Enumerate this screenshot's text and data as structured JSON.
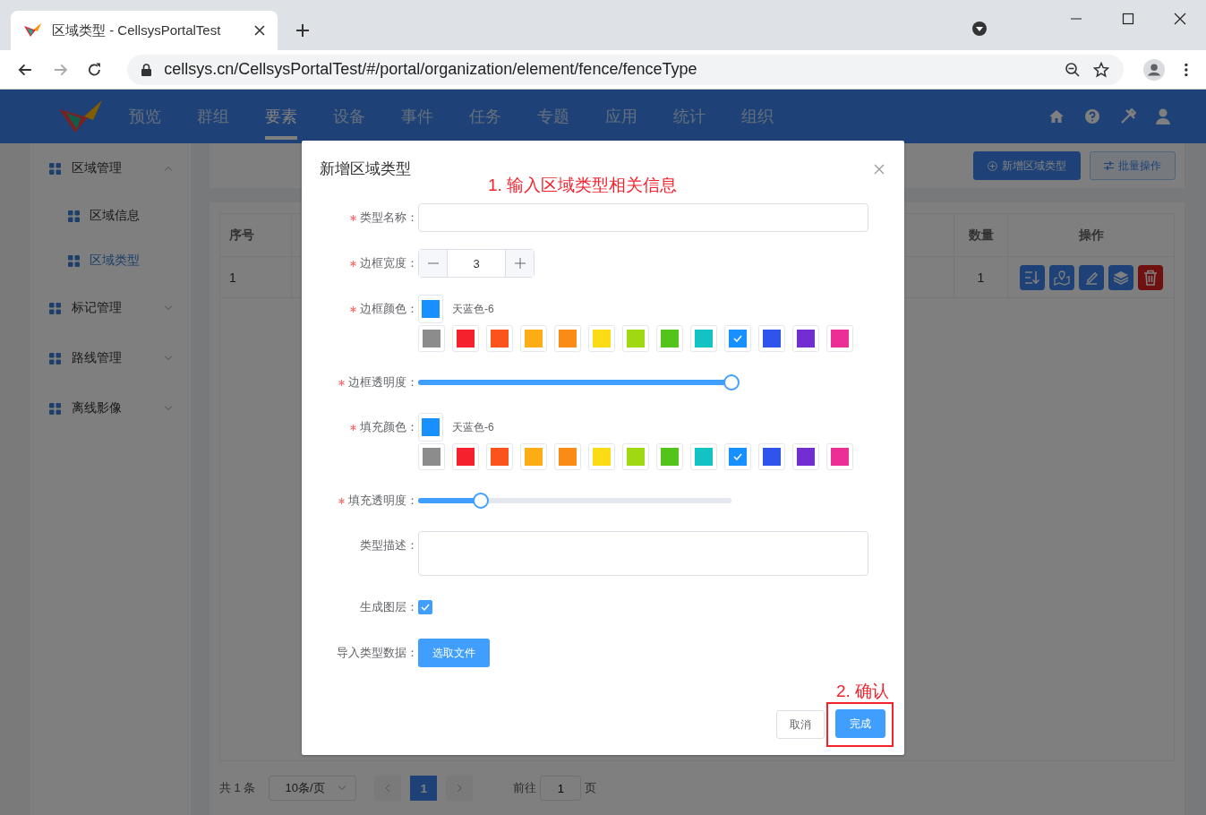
{
  "browser": {
    "tab_title": "区域类型 - CellsysPortalTest",
    "url": "cellsys.cn/CellsysPortalTest/#/portal/organization/element/fence/fenceType"
  },
  "nav": {
    "items": [
      {
        "label": "预览",
        "selected": false
      },
      {
        "label": "群组",
        "selected": false
      },
      {
        "label": "要素",
        "selected": true
      },
      {
        "label": "设备",
        "selected": false
      },
      {
        "label": "事件",
        "selected": false
      },
      {
        "label": "任务",
        "selected": false
      },
      {
        "label": "专题",
        "selected": false
      },
      {
        "label": "应用",
        "selected": false
      },
      {
        "label": "统计",
        "selected": false
      },
      {
        "label": "组织",
        "selected": false
      }
    ]
  },
  "sidebar": {
    "groups": [
      {
        "label": "区域管理",
        "expanded": true,
        "children": [
          {
            "label": "区域信息",
            "selected": false
          },
          {
            "label": "区域类型",
            "selected": true
          }
        ]
      },
      {
        "label": "标记管理",
        "expanded": false
      },
      {
        "label": "路线管理",
        "expanded": false
      },
      {
        "label": "离线影像",
        "expanded": false
      }
    ]
  },
  "toolbar": {
    "buttons": [
      {
        "label": "新增区域类型",
        "kind": "primary"
      },
      {
        "label": "批量操作",
        "kind": "plain"
      }
    ]
  },
  "table": {
    "columns": [
      "序号",
      "数量",
      "操作"
    ],
    "rows": [
      {
        "index": "1",
        "count": "1"
      }
    ]
  },
  "pagination": {
    "total": "共 1 条",
    "page_size": "10条/页",
    "pages": [
      {
        "label": "1",
        "selected": true
      }
    ],
    "goto_label": "前往",
    "goto_value": "1",
    "goto_suffix": "页"
  },
  "dialog": {
    "title": "新增区域类型",
    "note": "1. 输入区域类型相关信息",
    "fields": [
      {
        "kind": "text",
        "label": "类型名称：",
        "required": true
      },
      {
        "kind": "number",
        "label": "边框宽度：",
        "required": true,
        "value": "3"
      },
      {
        "kind": "color",
        "label": "边框颜色：",
        "required": true,
        "color": "#1890ff",
        "color_name": "天蓝色-6",
        "swatches": [
          {
            "color": "#8c8c8c",
            "selected": false
          },
          {
            "color": "#f5222d",
            "selected": false
          },
          {
            "color": "#fa541c",
            "selected": false
          },
          {
            "color": "#faad14",
            "selected": false
          },
          {
            "color": "#fa8c16",
            "selected": false
          },
          {
            "color": "#fadb14",
            "selected": false
          },
          {
            "color": "#a0d911",
            "selected": false
          },
          {
            "color": "#52c41a",
            "selected": false
          },
          {
            "color": "#13c2c2",
            "selected": false
          },
          {
            "color": "#1890ff",
            "selected": true
          },
          {
            "color": "#2f54eb",
            "selected": false
          },
          {
            "color": "#722ed1",
            "selected": false
          },
          {
            "color": "#eb2f96",
            "selected": false
          }
        ]
      },
      {
        "kind": "slider",
        "label": "边框透明度：",
        "required": true,
        "level": 1
      },
      {
        "kind": "color",
        "label": "填充颜色：",
        "required": true,
        "color": "#1890ff",
        "color_name": "天蓝色-6",
        "swatches": [
          {
            "color": "#8c8c8c",
            "selected": false
          },
          {
            "color": "#f5222d",
            "selected": false
          },
          {
            "color": "#fa541c",
            "selected": false
          },
          {
            "color": "#faad14",
            "selected": false
          },
          {
            "color": "#fa8c16",
            "selected": false
          },
          {
            "color": "#fadb14",
            "selected": false
          },
          {
            "color": "#a0d911",
            "selected": false
          },
          {
            "color": "#52c41a",
            "selected": false
          },
          {
            "color": "#13c2c2",
            "selected": false
          },
          {
            "color": "#1890ff",
            "selected": true
          },
          {
            "color": "#2f54eb",
            "selected": false
          },
          {
            "color": "#722ed1",
            "selected": false
          },
          {
            "color": "#eb2f96",
            "selected": false
          }
        ]
      },
      {
        "kind": "slider",
        "label": "填充透明度：",
        "required": true,
        "level": 0.2
      },
      {
        "kind": "textarea",
        "label": "类型描述：",
        "required": false
      },
      {
        "kind": "checkbox",
        "label": "生成图层：",
        "required": false,
        "checked": true
      },
      {
        "kind": "upload",
        "label": "导入类型数据：",
        "required": false,
        "button": "选取文件"
      }
    ],
    "confirm_note": "2. 确认",
    "buttons": [
      {
        "label": "取消",
        "kind": "plain",
        "highlighted": false
      },
      {
        "label": "完成",
        "kind": "primary",
        "highlighted": true
      }
    ]
  }
}
